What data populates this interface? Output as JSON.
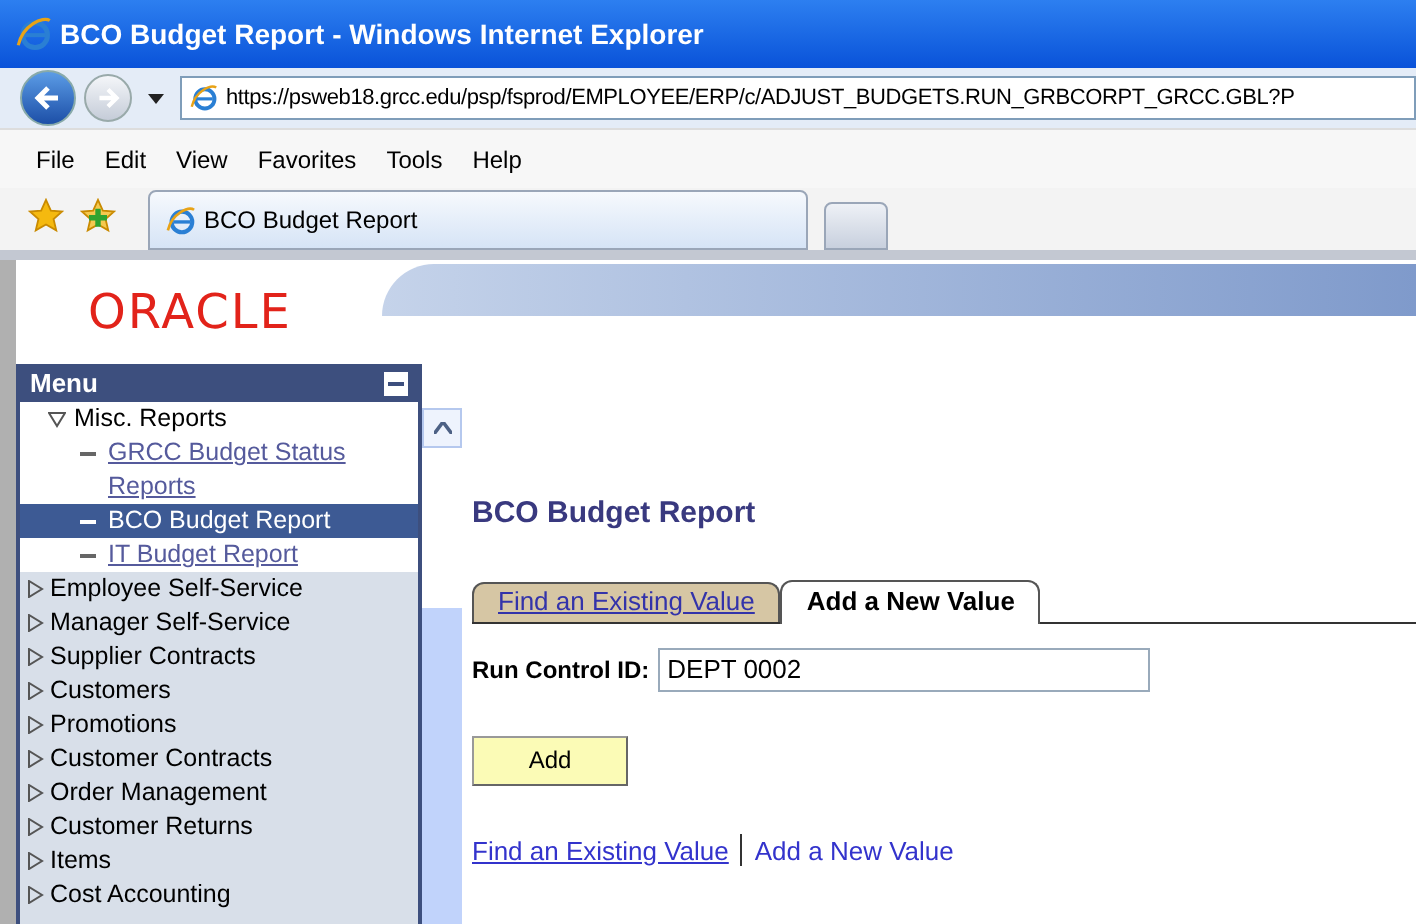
{
  "window": {
    "title": "BCO Budget Report - Windows Internet Explorer"
  },
  "address_bar": {
    "url": "https://psweb18.grcc.edu/psp/fsprod/EMPLOYEE/ERP/c/ADJUST_BUDGETS.RUN_GRBCORPT_GRCC.GBL?P"
  },
  "menu_bar": [
    "File",
    "Edit",
    "View",
    "Favorites",
    "Tools",
    "Help"
  ],
  "browser_tabs": [
    {
      "label": "BCO Budget Report",
      "selected": true
    }
  ],
  "logo": "ORACLE",
  "menu": {
    "title": "Menu",
    "items": [
      {
        "label": "Misc. Reports",
        "expanded": true,
        "children": [
          {
            "label": "GRCC Budget Status Reports",
            "selected": false
          },
          {
            "label": "BCO Budget Report",
            "selected": true
          },
          {
            "label": "IT Budget Report",
            "selected": false
          }
        ]
      },
      {
        "label": "Employee Self-Service",
        "expanded": false
      },
      {
        "label": "Manager Self-Service",
        "expanded": false
      },
      {
        "label": "Supplier Contracts",
        "expanded": false
      },
      {
        "label": "Customers",
        "expanded": false
      },
      {
        "label": "Promotions",
        "expanded": false
      },
      {
        "label": "Customer Contracts",
        "expanded": false
      },
      {
        "label": "Order Management",
        "expanded": false
      },
      {
        "label": "Customer Returns",
        "expanded": false
      },
      {
        "label": "Items",
        "expanded": false
      },
      {
        "label": "Cost Accounting",
        "expanded": false
      }
    ]
  },
  "page": {
    "title": "BCO Budget Report",
    "tabs": [
      {
        "label": "Find an Existing Value",
        "selected": false
      },
      {
        "label": "Add a New Value",
        "selected": true
      }
    ],
    "run_control": {
      "label": "Run Control ID:",
      "value": "DEPT 0002"
    },
    "button": "Add",
    "links": [
      "Find an Existing Value",
      "Add a New Value"
    ]
  }
}
